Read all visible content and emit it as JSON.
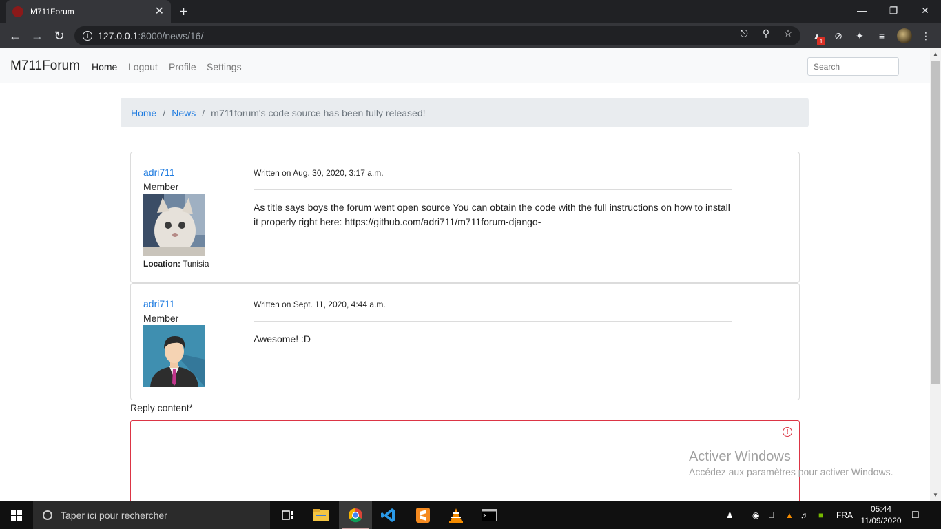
{
  "browser": {
    "tab_title": "M711Forum",
    "url_host": "127.0.0.1",
    "url_rest": ":8000/news/16/",
    "extension_badge": "1"
  },
  "navbar": {
    "brand": "M711Forum",
    "links": [
      "Home",
      "Logout",
      "Profile",
      "Settings"
    ],
    "search_placeholder": "Search"
  },
  "breadcrumb": {
    "items": [
      "Home",
      "News"
    ],
    "current": "m711forum's code source has been fully released!"
  },
  "posts": [
    {
      "author": "adri711",
      "role": "Member",
      "location_label": "Location:",
      "location": "Tunisia",
      "written": "Written on Aug. 30, 2020, 3:17 a.m.",
      "content": "As title says boys the forum went open source You can obtain the code with the full instructions on how to install it properly right here: https://github.com/adri711/m711forum-django-"
    },
    {
      "author": "adri711",
      "role": "Member",
      "written": "Written on Sept. 11, 2020, 4:44 a.m.",
      "content": "Awesome! :D"
    }
  ],
  "reply": {
    "label": "Reply content*",
    "value": ""
  },
  "watermark": {
    "title": "Activer Windows",
    "subtitle": "Accédez aux paramètres pour activer Windows."
  },
  "taskbar": {
    "search_placeholder": "Taper ici pour rechercher",
    "language": "FRA",
    "time": "05:44",
    "date": "11/09/2020"
  },
  "colors": {
    "link": "#1e7be0",
    "error": "#dc3545",
    "navbar_bg": "#f8f9fa",
    "breadcrumb_bg": "#e9ecef"
  }
}
